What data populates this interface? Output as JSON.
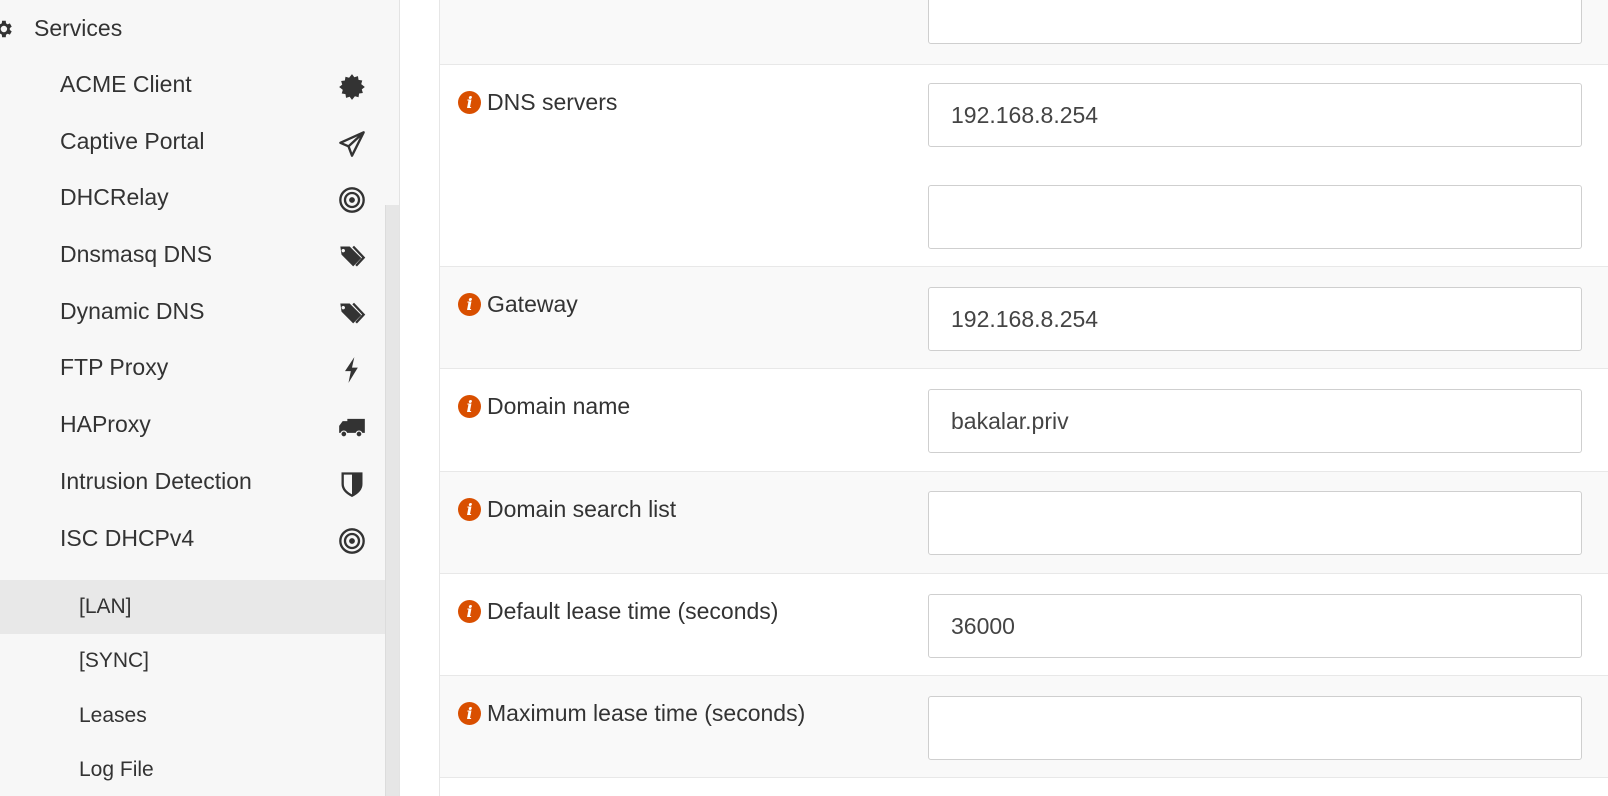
{
  "sidebar": {
    "section_title": "Services",
    "items": [
      {
        "label": "ACME Client"
      },
      {
        "label": "Captive Portal"
      },
      {
        "label": "DHCRelay"
      },
      {
        "label": "Dnsmasq DNS"
      },
      {
        "label": "Dynamic DNS"
      },
      {
        "label": "FTP Proxy"
      },
      {
        "label": "HAProxy"
      },
      {
        "label": "Intrusion Detection"
      },
      {
        "label": "ISC DHCPv4"
      }
    ],
    "subitems": [
      {
        "label": "[LAN]"
      },
      {
        "label": "[SYNC]"
      },
      {
        "label": "Leases"
      },
      {
        "label": "Log File"
      }
    ]
  },
  "form": {
    "dns_servers": {
      "label": "DNS servers",
      "value1": "192.168.8.254",
      "value2": ""
    },
    "gateway": {
      "label": "Gateway",
      "value": "192.168.8.254"
    },
    "domain_name": {
      "label": "Domain name",
      "value": "bakalar.priv"
    },
    "domain_search_list": {
      "label": "Domain search list",
      "value": ""
    },
    "default_lease_time": {
      "label": "Default lease time (seconds)",
      "value": "36000"
    },
    "max_lease_time": {
      "label": "Maximum lease time (seconds)",
      "value": ""
    }
  },
  "colors": {
    "info_icon": "#d94f00",
    "active_bg": "#e8e8e8"
  }
}
